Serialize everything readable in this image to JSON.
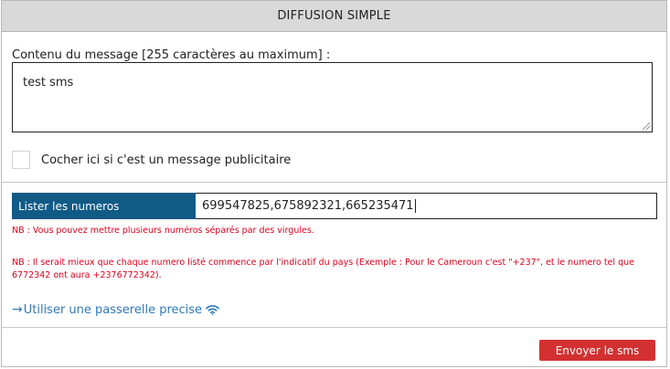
{
  "header": {
    "title": "DIFFUSION SIMPLE"
  },
  "message": {
    "label": "Contenu du message [255 caractères au maximum] :",
    "value": "test sms"
  },
  "advert_checkbox": {
    "label": "Cocher ici si c'est un message publicitaire",
    "checked": false
  },
  "numbers": {
    "label": "Lister les numeros",
    "value": "699547825,675892321,665235471"
  },
  "notes": {
    "note1": "NB : Vous pouvez mettre plusieurs numéros séparés par des virgules.",
    "note2": "NB : Il serait mieux que chaque numero listé commence par l'indicatif du pays (Exemple : Pour le Cameroun c'est \"+237\", et le numero tel que 6772342 ont aura +2376772342)."
  },
  "gateway": {
    "arrow": "→",
    "label": "Utiliser une passerelle precise"
  },
  "footer": {
    "send_label": "Envoyer le sms"
  },
  "colors": {
    "label_bg": "#105b86",
    "link": "#2e7ab8",
    "note": "#e0001b",
    "button": "#d33131"
  }
}
